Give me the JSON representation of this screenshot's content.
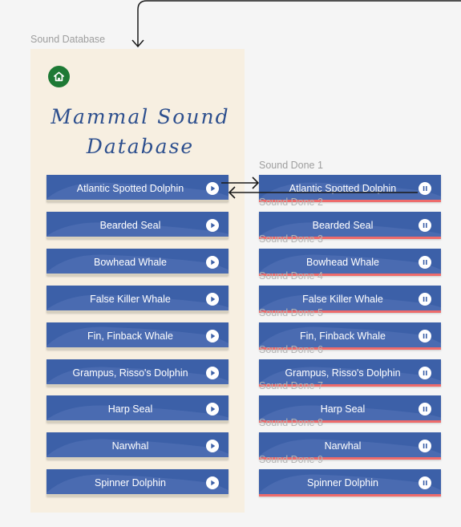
{
  "frames": {
    "main_label": "Sound Database",
    "done_labels": [
      "Sound Done 1",
      "Sound Done 2",
      "Sound Done 3",
      "Sound Done 4",
      "Sound Done 5",
      "Sound Done 6",
      "Sound Done 7",
      "Sound Done 8",
      "Sound Done 9"
    ]
  },
  "header": {
    "home_icon": "home-icon",
    "title_line1": "Mammal Sound",
    "title_line2": "Database"
  },
  "sounds": [
    "Atlantic Spotted Dolphin",
    "Bearded Seal",
    "Bowhead Whale",
    "False Killer Whale",
    "Fin, Finback Whale",
    "Grampus, Risso's Dolphin",
    "Harp Seal",
    "Narwhal",
    "Spinner Dolphin"
  ],
  "icons": {
    "play": "play-icon",
    "pause": "pause-icon"
  },
  "colors": {
    "card": "#3c60a8",
    "home": "#1e7a35",
    "frame_bg": "#f7efe1",
    "playing_underline": "#ee6b6b",
    "title": "#2d4f8e"
  }
}
